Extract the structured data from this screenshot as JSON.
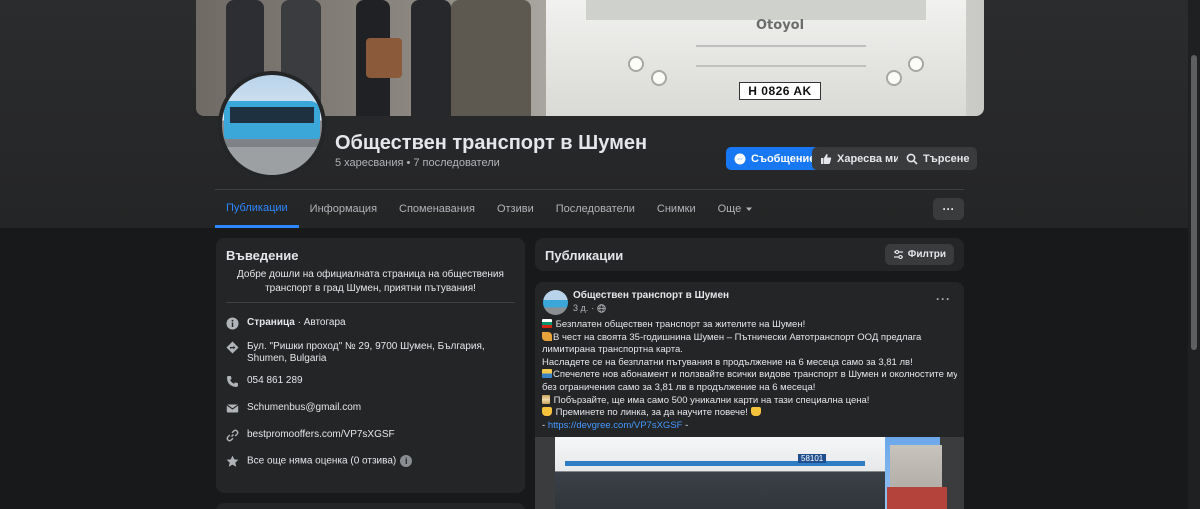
{
  "page": {
    "name": "Обществен транспорт в Шумен",
    "stats": "5 харесвания • 7 последователи"
  },
  "cover": {
    "bus_brand": "Otoyol",
    "plate": "H 0826 AK"
  },
  "actions": {
    "message": "Съобщение",
    "like": "Харесва ми",
    "search": "Търсене"
  },
  "tabs": [
    {
      "label": "Публикации",
      "active": true
    },
    {
      "label": "Информация"
    },
    {
      "label": "Споменавания"
    },
    {
      "label": "Отзиви"
    },
    {
      "label": "Последователи"
    },
    {
      "label": "Снимки"
    },
    {
      "label": "Още"
    }
  ],
  "intro": {
    "heading": "Въведение",
    "description": "Добре дошли на официалната страница на обществения транспорт в град Шумен, приятни пътувания!",
    "category_bold": "Страница",
    "category_rest": " · Автогара",
    "address": "Бул. \"Ришки проход\" № 29, 9700 Шумен, България, Shumen, Bulgaria",
    "phone": "054 861 289",
    "email": "Schumenbus@gmail.com",
    "website": "bestpromooffers.com/VP7sXGSF",
    "rating": "Все още няма оценка (0 отзива)"
  },
  "posts_section": {
    "title": "Публикации",
    "filter_label": "Филтри"
  },
  "post": {
    "author": "Обществен транспорт в Шумен",
    "time": "3 д.",
    "lines": [
      "Безплатен обществен транспорт за жителите на Шумен!",
      "В чест на своята 35-годишнина Шумен – Пътнически Автотранспорт ООД предлага",
      "лимитирана транспортна карта.",
      "Насладете се на безплатни пътувания в продължение на 6 месеца само за 3,81 лв!",
      "Спечелете нов абонамент и ползвайте всички видове транспорт в Шумен и околностите му",
      "без ограничения само за 3,81 лв в продължение на 6 месеца!",
      "Побързайте, ще има само 500 уникални карти на тази специална цена!",
      "Преминете по линка, за да научите повече!",
      "https://devgree.com/VP7sXGSF"
    ],
    "link_prefix": "- ",
    "link_suffix": " -",
    "image_fleet_number": "58101"
  },
  "colors": {
    "accent": "#1877f2",
    "active_tab": "#2d88ff",
    "card_bg": "#242526",
    "page_bg": "#18191a",
    "link": "#4599ff"
  },
  "icons": [
    "messenger-icon",
    "thumbs-up-icon",
    "search-icon",
    "info-icon",
    "location-icon",
    "phone-icon",
    "email-icon",
    "link-icon",
    "star-icon",
    "filter-icon",
    "globe-icon",
    "more-icon",
    "caret-down-icon"
  ]
}
